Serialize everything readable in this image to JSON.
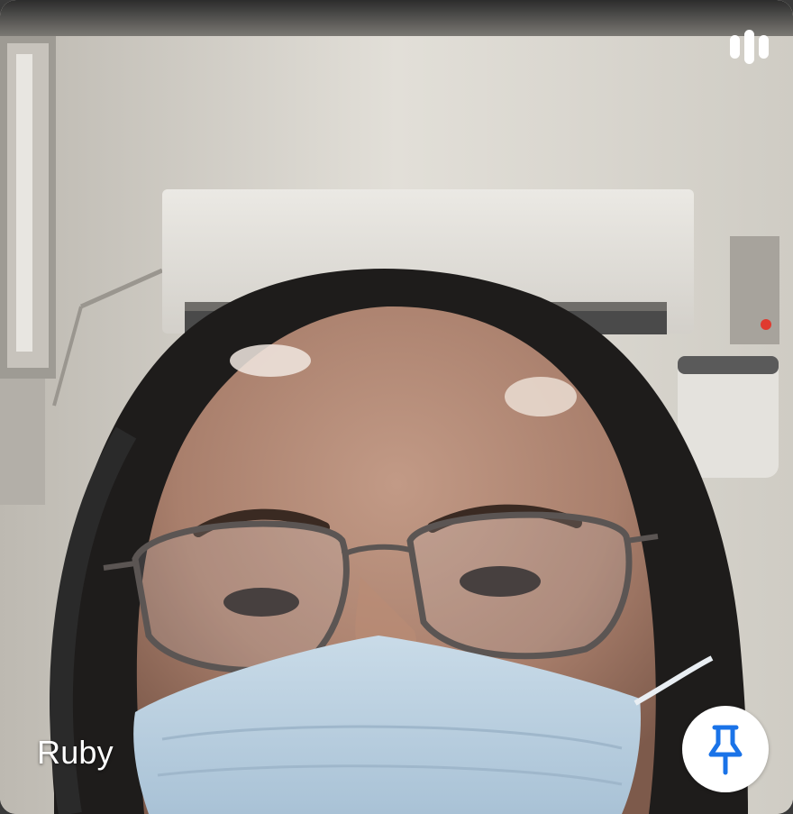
{
  "participant": {
    "name": "Ruby"
  },
  "icons": {
    "speaking_indicator": "audio-level-bars-icon",
    "pin": "pin-icon"
  },
  "colors": {
    "accent": "#1a73e8",
    "overlay_text": "#ffffff",
    "pin_button_bg": "#ffffff"
  }
}
